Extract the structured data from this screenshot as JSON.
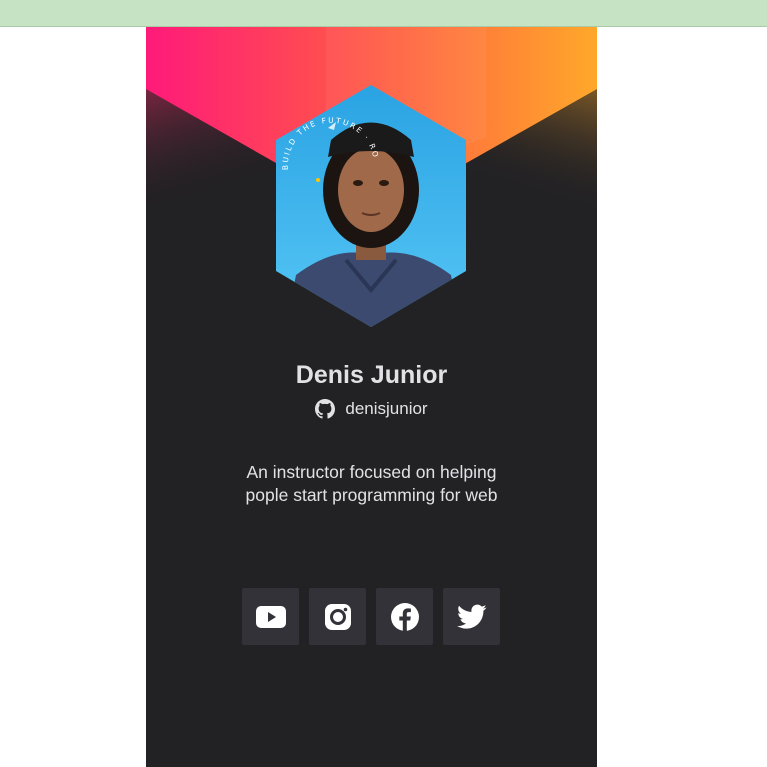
{
  "profile": {
    "name": "Denis Junior",
    "github_username": "denisjunior",
    "bio_line1": "An instructor focused on helping",
    "bio_line2": "pople start programming for web",
    "badge_text": "BUILD THE FUTURE · ROCKET"
  },
  "socials": [
    {
      "name": "youtube",
      "icon": "youtube-icon"
    },
    {
      "name": "instagram",
      "icon": "instagram-icon"
    },
    {
      "name": "facebook",
      "icon": "facebook-icon"
    },
    {
      "name": "twitter",
      "icon": "twitter-icon"
    }
  ],
  "colors": {
    "card_bg": "#222124",
    "gradient_start": "#ff1a7a",
    "gradient_mid": "#ff5a45",
    "gradient_end": "#ffa82a",
    "text": "#e2e1e6",
    "button_bg": "#323238",
    "top_bar": "#c6e3c4"
  }
}
